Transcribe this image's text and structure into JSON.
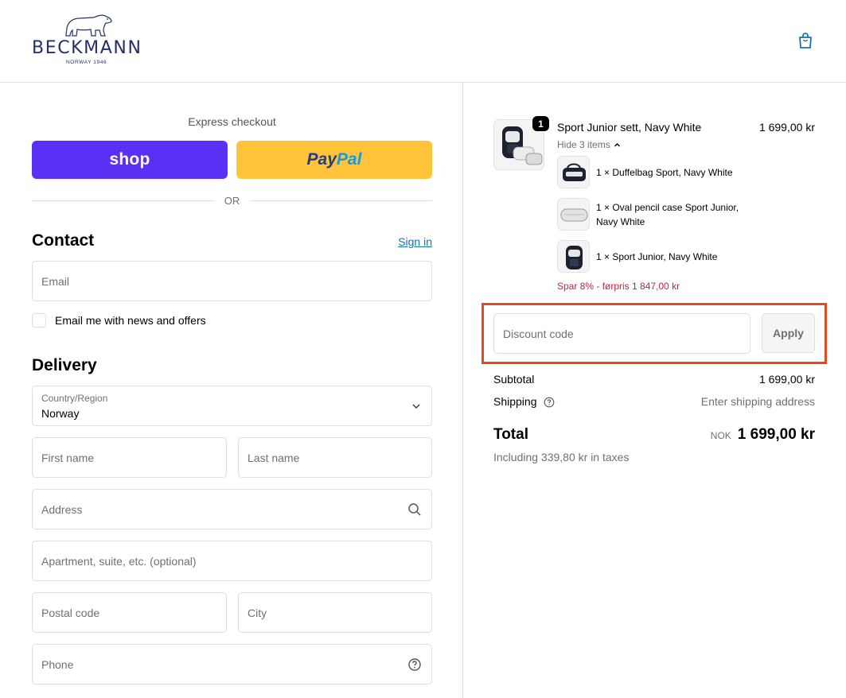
{
  "header": {
    "brand_name": "BECKMANN",
    "brand_tagline": "NORWAY 1946",
    "cart_icon": "shopping-bag-icon"
  },
  "express": {
    "title": "Express checkout",
    "shop_label": "shop",
    "paypal_label_a": "Pay",
    "paypal_label_b": "Pal",
    "or_text": "OR",
    "colors": {
      "shop": "#5a31f4",
      "paypal": "#ffc439"
    }
  },
  "contact": {
    "heading": "Contact",
    "sign_in": "Sign in",
    "email_placeholder": "Email",
    "newsletter_label": "Email me with news and offers"
  },
  "delivery": {
    "heading": "Delivery",
    "country_label": "Country/Region",
    "country_value": "Norway",
    "first_name_placeholder": "First name",
    "last_name_placeholder": "Last name",
    "address_placeholder": "Address",
    "apartment_placeholder": "Apartment, suite, etc. (optional)",
    "postal_placeholder": "Postal code",
    "city_placeholder": "City",
    "phone_placeholder": "Phone"
  },
  "order": {
    "product": {
      "title": "Sport Junior sett, Navy White",
      "price": "1 699,00 kr",
      "quantity": "1",
      "toggle_label": "Hide 3 items",
      "items": [
        {
          "line1": "1 × Duffelbag Sport, Navy White",
          "line2": ""
        },
        {
          "line1": "1 × Oval pencil case Sport Junior,",
          "line2": "Navy White"
        },
        {
          "line1": "1 × Sport Junior, Navy White",
          "line2": ""
        }
      ],
      "savings": "Spar 8% - førpris 1 847,00 kr"
    },
    "discount": {
      "placeholder": "Discount code",
      "apply_label": "Apply",
      "highlight_color": "#e8471c"
    },
    "summary": {
      "subtotal_label": "Subtotal",
      "subtotal_value": "1 699,00 kr",
      "shipping_label": "Shipping",
      "shipping_value": "Enter shipping address",
      "total_label": "Total",
      "total_currency": "NOK",
      "total_value": "1 699,00 kr",
      "taxes_note": "Including 339,80 kr in taxes"
    }
  }
}
